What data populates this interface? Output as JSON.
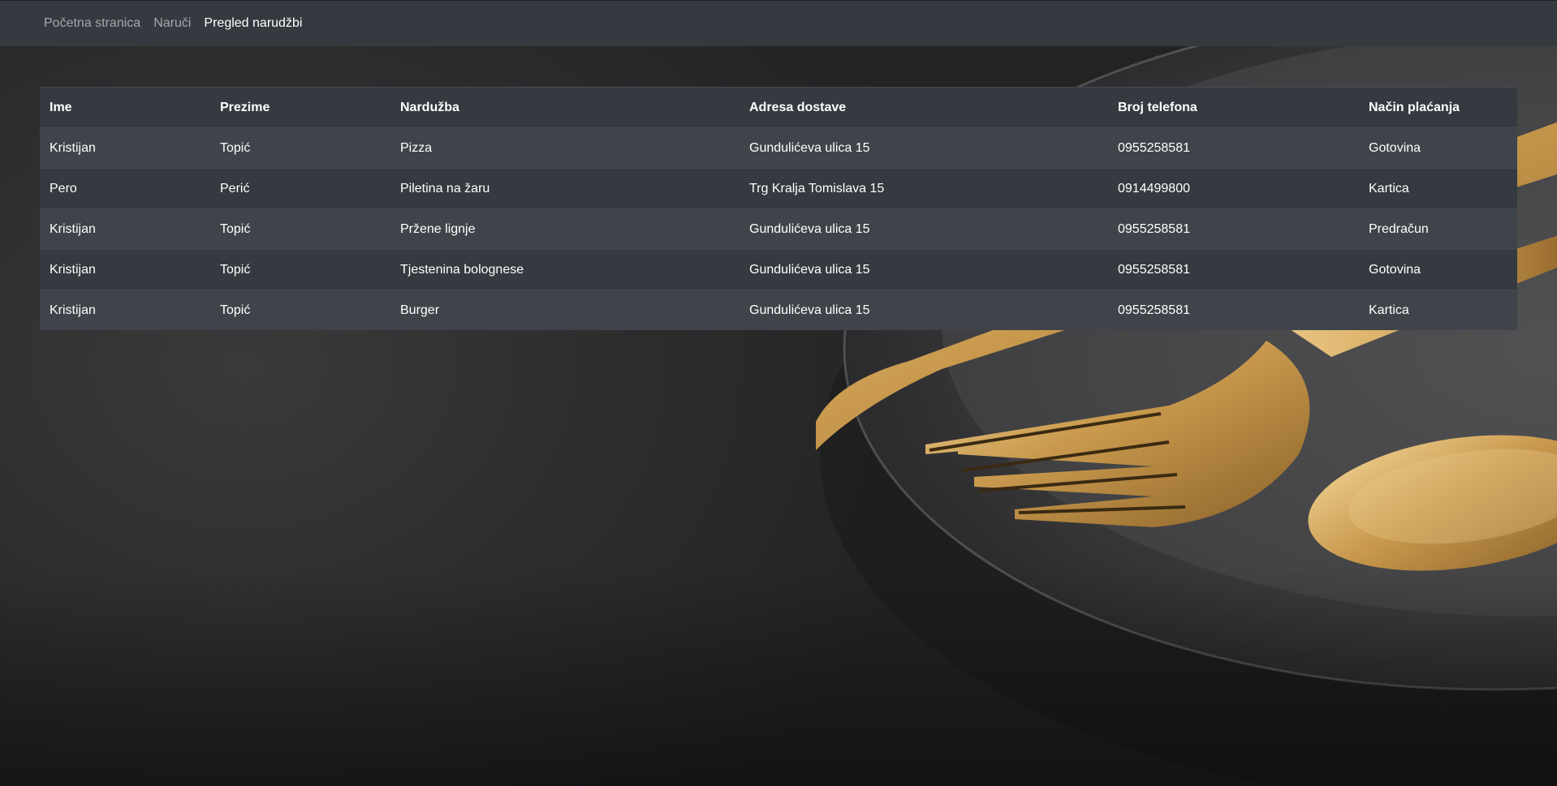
{
  "nav": {
    "items": [
      {
        "label": "Početna stranica",
        "active": false
      },
      {
        "label": "Naruči",
        "active": false
      },
      {
        "label": "Pregled narudžbi",
        "active": true
      }
    ]
  },
  "table": {
    "headers": [
      "Ime",
      "Prezime",
      "Nardužba",
      "Adresa dostave",
      "Broj telefona",
      "Način plaćanja"
    ],
    "rows": [
      [
        "Kristijan",
        "Topić",
        "Pizza",
        "Gundulićeva ulica 15",
        "0955258581",
        "Gotovina"
      ],
      [
        "Pero",
        "Perić",
        "Piletina na žaru",
        "Trg Kralja Tomislava 15",
        "0914499800",
        "Kartica"
      ],
      [
        "Kristijan",
        "Topić",
        "Pržene lignje",
        "Gundulićeva ulica 15",
        "0955258581",
        "Predračun"
      ],
      [
        "Kristijan",
        "Topić",
        "Tjestenina bolognese",
        "Gundulićeva ulica 15",
        "0955258581",
        "Gotovina"
      ],
      [
        "Kristijan",
        "Topić",
        "Burger",
        "Gundulićeva ulica 15",
        "0955258581",
        "Kartica"
      ]
    ]
  },
  "colors": {
    "navbar_bg": "#343a40",
    "table_dark": "#343a40",
    "table_striped": "#3e444a",
    "cutlery_gold": "#c9a15a"
  }
}
